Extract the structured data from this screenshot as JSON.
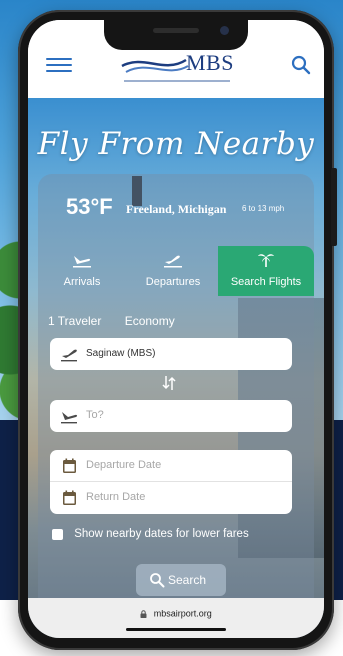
{
  "header": {
    "logo_text": "MBS",
    "brand_color": "#1d3d80",
    "icons": {
      "menu": "hamburger-icon",
      "search": "search-icon"
    }
  },
  "hero": {
    "title": "Fly From Nearby"
  },
  "weather": {
    "temperature": "53°F",
    "location": "Freeland, Michigan",
    "wind": "6 to 13 mph"
  },
  "tabs": [
    {
      "label": "Arrivals",
      "icon": "plane-landing-icon",
      "active": false
    },
    {
      "label": "Departures",
      "icon": "plane-takeoff-icon",
      "active": false
    },
    {
      "label": "Search Flights",
      "icon": "palm-tree-icon",
      "active": true
    }
  ],
  "accent_color": "#2aa874",
  "trip_options": {
    "travelers": "1 Traveler",
    "cabin": "Economy"
  },
  "form": {
    "from_value": "Saginaw (MBS)",
    "to_placeholder": "To?",
    "departure_placeholder": "Departure Date",
    "return_placeholder": "Return Date",
    "nearby_dates_label": "Show nearby dates for lower fares",
    "nearby_dates_checked": false,
    "search_label": "Search"
  },
  "browser": {
    "url": "mbsairport.org"
  }
}
